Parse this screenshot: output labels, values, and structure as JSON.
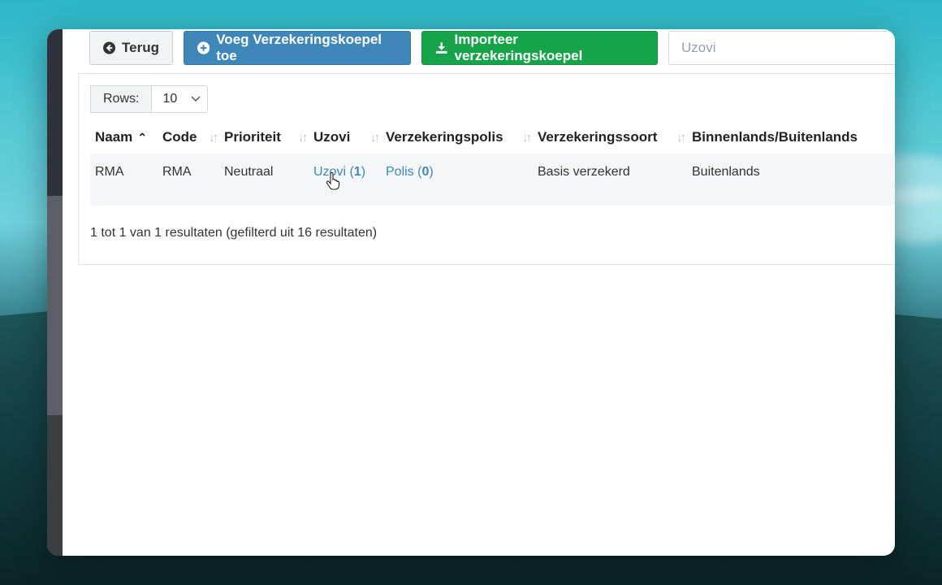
{
  "toolbar": {
    "back_label": "Terug",
    "add_label": "Voeg Verzekeringskoepel toe",
    "import_label": "Importeer verzekeringskoepel",
    "search_placeholder": "Uzovi",
    "search_value": ""
  },
  "rows": {
    "label": "Rows:",
    "value": "10"
  },
  "table": {
    "headers": [
      "Naam",
      "Code",
      "Prioriteit",
      "Uzovi",
      "Verzekeringspolis",
      "Verzekeringssoort",
      "Binnenlands/Buitenlands"
    ],
    "rows": [
      {
        "naam": "RMA",
        "code": "RMA",
        "prioriteit": "Neutraal",
        "uzovi_text": "Uzovi (",
        "uzovi_count": "1",
        "uzovi_close": ")",
        "polis_text": "Polis (",
        "polis_count": "0",
        "polis_close": ")",
        "soort": "Basis verzekerd",
        "binnen_buiten": "Buitenlands"
      }
    ]
  },
  "result_info": "1 tot 1 van 1 resultaten (gefilterd uit 16 resultaten)",
  "colors": {
    "primary": "#3f87b9",
    "success": "#16a34a",
    "link": "#3f87b9"
  }
}
